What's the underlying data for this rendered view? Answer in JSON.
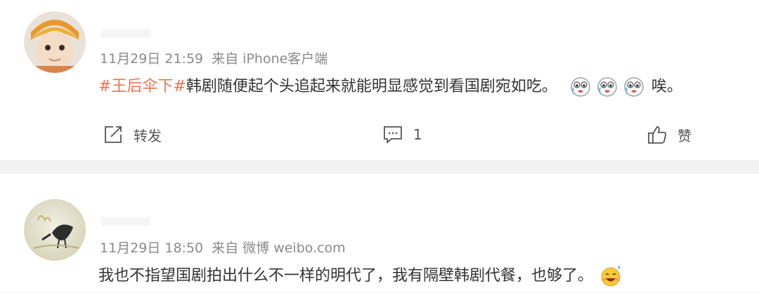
{
  "posts": [
    {
      "meta": {
        "date": "11月29日",
        "time": "21:59",
        "source": "来自 iPhone客户端"
      },
      "content": {
        "hashtag": "#王后伞下#",
        "text": "韩剧随便起个头追起来就能明显感觉到看国剧宛如吃",
        "punct": "。",
        "trail": "唉。"
      },
      "emoji_icons": [
        "crying-face-icon",
        "crying-face-icon",
        "crying-face-icon"
      ],
      "actions": {
        "forward_label": "转发",
        "comment_count": "1",
        "like_label": "赞"
      }
    },
    {
      "meta": {
        "date": "11月29日",
        "time": "18:50",
        "source": "来自 微博 weibo.com"
      },
      "content": {
        "text": "我也不指望国剧拍出什么不一样的明代了，我有隔壁韩剧代餐，也够了。"
      },
      "emoji_icons": [
        "laughing-face-icon"
      ]
    }
  ],
  "colors": {
    "hashtag": "#eb7350",
    "meta_text": "#8a8a8a",
    "body_text": "#333333",
    "feed_background": "#f2f2f2"
  }
}
